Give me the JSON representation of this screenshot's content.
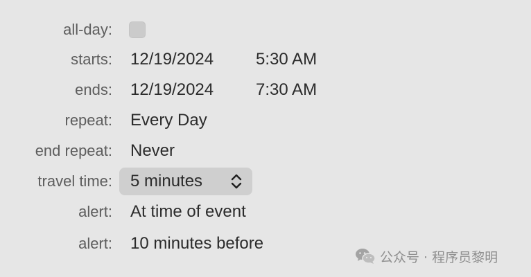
{
  "form": {
    "all_day": {
      "label": "all-day:",
      "checked": false
    },
    "starts": {
      "label": "starts:",
      "date": "12/19/2024",
      "time": "5:30 AM"
    },
    "ends": {
      "label": "ends:",
      "date": "12/19/2024",
      "time": "7:30 AM"
    },
    "repeat": {
      "label": "repeat:",
      "value": "Every Day"
    },
    "end_repeat": {
      "label": "end repeat:",
      "value": "Never"
    },
    "travel_time": {
      "label": "travel time:",
      "value": "5 minutes",
      "icon": "chevron-up-down-icon"
    },
    "alert_1": {
      "label": "alert:",
      "value": "At time of event"
    },
    "alert_2": {
      "label": "alert:",
      "value": "10 minutes before"
    }
  },
  "watermark": {
    "text": "公众号 · 程序员黎明",
    "icon": "wechat-icon"
  },
  "colors": {
    "background": "#e6e6e6",
    "label_text": "#5d5d5d",
    "value_text": "#2b2b2b",
    "popup_background": "#cfcfcf",
    "checkbox_fill": "#cbcbcb"
  }
}
